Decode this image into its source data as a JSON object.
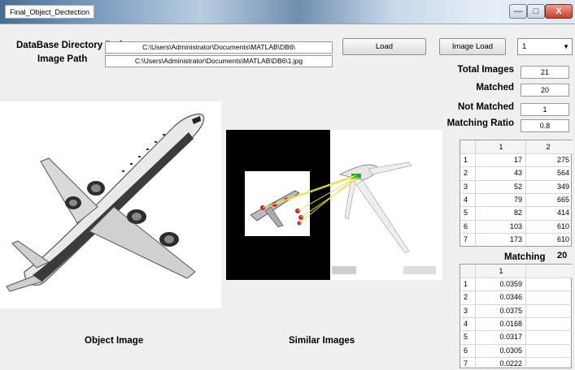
{
  "window": {
    "title": "Final_Object_Dectection",
    "min_glyph": "—",
    "max_glyph": "□",
    "close_glyph": "X"
  },
  "form": {
    "db_label": "DataBase Directory Path",
    "db_value": "C:\\Users\\Administrator\\Documents\\MATLAB\\DB6\\",
    "image_label": "Image  Path",
    "image_value": "C:\\Users\\Administrator\\Documents\\MATLAB\\DB6\\1.jpg",
    "load_label": "Load",
    "image_load_label": "Image Load",
    "select_value": "1"
  },
  "stats": {
    "total_label": "Total Images",
    "total_value": "21",
    "matched_label": "Matched",
    "matched_value": "20",
    "not_matched_label": "Not Matched",
    "not_matched_value": "1",
    "ratio_label": "Matching Ratio",
    "ratio_value": "0.8"
  },
  "table1": {
    "headers": [
      "1",
      "2"
    ],
    "rows": [
      [
        "1",
        "17",
        "275"
      ],
      [
        "2",
        "43",
        "564"
      ],
      [
        "3",
        "52",
        "349"
      ],
      [
        "4",
        "79",
        "665"
      ],
      [
        "5",
        "82",
        "414"
      ],
      [
        "6",
        "103",
        "610"
      ],
      [
        "7",
        "173",
        "610"
      ]
    ]
  },
  "matching": {
    "label": "Matching",
    "count": "20"
  },
  "table2": {
    "headers": [
      "1"
    ],
    "rows": [
      [
        "1",
        "0.0359"
      ],
      [
        "2",
        "0.0346"
      ],
      [
        "3",
        "0.0375"
      ],
      [
        "4",
        "0.0168"
      ],
      [
        "5",
        "0.0317"
      ],
      [
        "6",
        "0.0305"
      ],
      [
        "7",
        "0.0222"
      ]
    ]
  },
  "captions": {
    "object": "Object Image",
    "similar": "Similar  Images"
  },
  "colors": {
    "match_line": "#e6e040",
    "keypoint": "#d42020",
    "keypoint_target": "#22aa22"
  }
}
